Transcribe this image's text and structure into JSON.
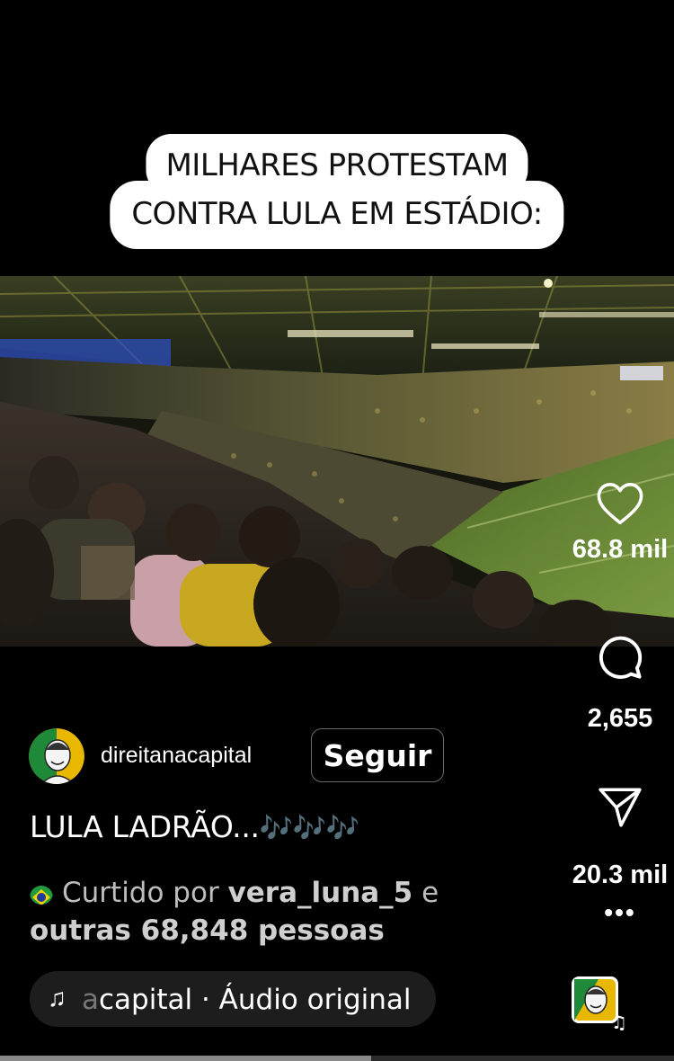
{
  "overlay_caption": {
    "line1": "MILHARES PROTESTAM",
    "line2": "CONTRA LULA EM ESTÁDIO:"
  },
  "actions": {
    "likes": "68.8 mil",
    "comments": "2,655",
    "shares": "20.3 mil",
    "more": "•••"
  },
  "post": {
    "username": "direitanacapital",
    "follow_label": "Seguir",
    "caption": "LULA LADRÃO...",
    "caption_emoji": "🎶🎶🎶",
    "liked_prefix": "Curtido por",
    "liked_user": "vera_luna_5",
    "liked_joiner": "e",
    "liked_others": "outras 68,848 pessoas",
    "audio_prefix": "a",
    "audio_label": "capital · Áudio original",
    "audio_icon": "music-note-icon"
  },
  "colors": {
    "background": "#000000",
    "caption_bg": "#ffffff",
    "pill_bg": "#1d1d1d",
    "field_green": "#5d7a2e",
    "crowd_yellow": "#c8a820"
  },
  "progress": {
    "fraction": 0.55
  }
}
